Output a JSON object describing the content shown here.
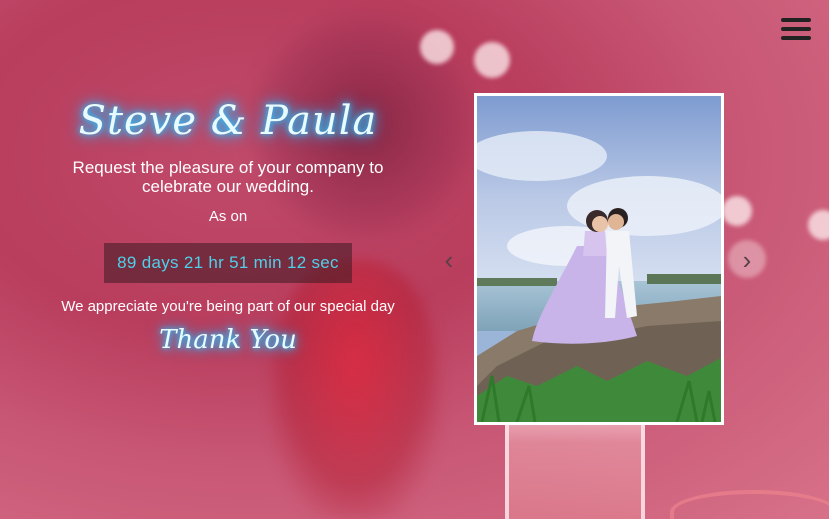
{
  "hero": {
    "names": "Steve & Paula",
    "invite_text": "Request the pleasure of your company to celebrate our wedding.",
    "as_on": "As on",
    "countdown": "89 days 21 hr 51 min 12 sec",
    "appreciation": "We appreciate you're being part of our special day",
    "thanks": "Thank You"
  },
  "nav": {
    "menu_icon": "hamburger-menu-icon"
  },
  "carousel": {
    "prev_icon": "chevron-left-icon",
    "next_icon": "chevron-right-icon",
    "prev_glyph": "‹",
    "next_glyph": "›",
    "slide_image": "wedding-couple-photo"
  },
  "colors": {
    "background": "#c04a6a",
    "neon_glow": "#29c7ff",
    "countdown_text": "#4fd0e8"
  }
}
